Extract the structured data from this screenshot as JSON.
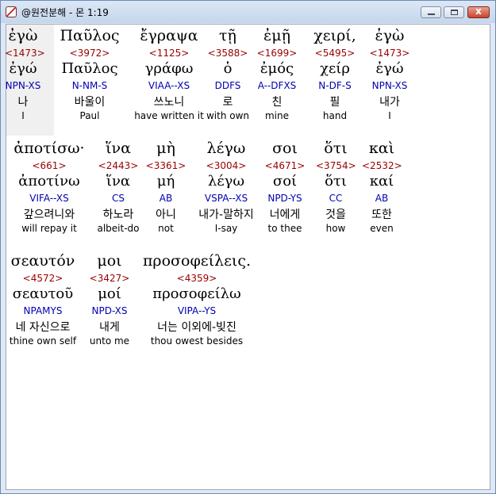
{
  "window": {
    "title": "@원전분해 - 몬 1:19",
    "minimize_label": "",
    "maximize_label": "",
    "close_label": "x"
  },
  "rows": [
    {
      "words": [
        {
          "greek": "ἐγὼ",
          "strong": "<1473>",
          "lemma": "ἐγώ",
          "parse": "NPN-XS",
          "korean": "나",
          "english": "I"
        },
        {
          "greek": "Παῦλος",
          "strong": "<3972>",
          "lemma": "Παῦλος",
          "parse": "N-NM-S",
          "korean": "바울이",
          "english": "Paul"
        },
        {
          "greek": "ἔγραψα",
          "strong": "<1125>",
          "lemma": "γράφω",
          "parse": "VIAA--XS",
          "korean": "쓰노니",
          "english": "have written it"
        },
        {
          "greek": "τῇ",
          "strong": "<3588>",
          "lemma": "ὁ",
          "parse": "DDFS",
          "korean": "로",
          "english": "with own"
        },
        {
          "greek": "ἐμῇ",
          "strong": "<1699>",
          "lemma": "ἐμός",
          "parse": "A--DFXS",
          "korean": "친",
          "english": "mine"
        },
        {
          "greek": "χειρί,",
          "strong": "<5495>",
          "lemma": "χείρ",
          "parse": "N-DF-S",
          "korean": "필",
          "english": "hand"
        },
        {
          "greek": "ἐγὼ",
          "strong": "<1473>",
          "lemma": "ἐγώ",
          "parse": "NPN-XS",
          "korean": "내가",
          "english": "I"
        }
      ]
    },
    {
      "words": [
        {
          "greek": "ἀποτίσω·",
          "strong": "<661>",
          "lemma": "ἀποτίνω",
          "parse": "VIFA--XS",
          "korean": "갚으려니와",
          "english": "will repay it"
        },
        {
          "greek": "ἵνα",
          "strong": "<2443>",
          "lemma": "ἵνα",
          "parse": "CS",
          "korean": "하노라",
          "english": "albeit-do"
        },
        {
          "greek": "μὴ",
          "strong": "<3361>",
          "lemma": "μή",
          "parse": "AB",
          "korean": "아니",
          "english": "not"
        },
        {
          "greek": "λέγω",
          "strong": "<3004>",
          "lemma": "λέγω",
          "parse": "VSPA--XS",
          "korean": "내가-말하지",
          "english": "I-say"
        },
        {
          "greek": "σοι",
          "strong": "<4671>",
          "lemma": "σοί",
          "parse": "NPD-YS",
          "korean": "너에게",
          "english": "to thee"
        },
        {
          "greek": "ὅτι",
          "strong": "<3754>",
          "lemma": "ὅτι",
          "parse": "CC",
          "korean": "것을",
          "english": "how"
        },
        {
          "greek": "καὶ",
          "strong": "<2532>",
          "lemma": "καί",
          "parse": "AB",
          "korean": "또한",
          "english": "even"
        }
      ]
    },
    {
      "words": [
        {
          "greek": "σεαυτόν",
          "strong": "<4572>",
          "lemma": "σεαυτοῦ",
          "parse": "NPAMYS",
          "korean": "네 자신으로",
          "english": "thine own self"
        },
        {
          "greek": "μοι",
          "strong": "<3427>",
          "lemma": "μοί",
          "parse": "NPD-XS",
          "korean": "내게",
          "english": "unto me"
        },
        {
          "greek": "προσοφείλεις.",
          "strong": "<4359>",
          "lemma": "προσοφείλω",
          "parse": "VIPA--YS",
          "korean": "너는 이외에-빚진",
          "english": "thou owest besides"
        }
      ]
    }
  ]
}
